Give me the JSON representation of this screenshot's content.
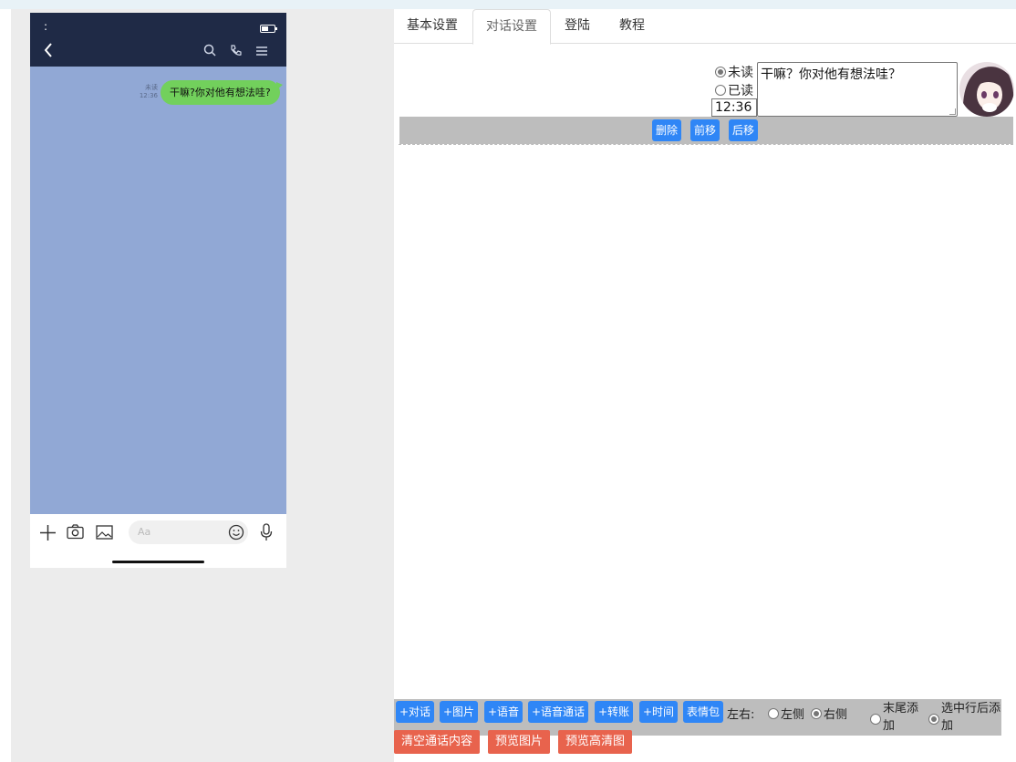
{
  "phone": {
    "status_left": ":",
    "message": {
      "status": "未读",
      "time": "12:36",
      "text": "干嘛?你对他有想法哇?"
    },
    "input_placeholder": "Aa",
    "colors": {
      "header": "#1f2a46",
      "chat_bg": "#91a8d5",
      "bubble": "#72d05c"
    }
  },
  "tabs": [
    {
      "label": "基本设置"
    },
    {
      "label": "对话设置"
    },
    {
      "label": "登陆"
    },
    {
      "label": "教程"
    }
  ],
  "active_tab": "对话设置",
  "dialog_row": {
    "unread_label": "未读",
    "read_label": "已读",
    "selected_status": "未读",
    "time_value": "12:36",
    "text_value": "干嘛？你对他有想法哇？",
    "actions": {
      "delete": "删除",
      "move_up": "前移",
      "move_down": "后移"
    }
  },
  "toolbar": {
    "add_dialog": "+对话",
    "add_image": "+图片",
    "add_voice": "+语音",
    "add_voice_call": "+语音通话",
    "add_transfer": "+转账",
    "add_time": "+时间",
    "sticker": "表情包",
    "side_label": "左右:",
    "left": "左侧",
    "right": "右侧",
    "selected_side": "右侧",
    "append_end": "末尾添加",
    "append_after": "选中行后添加",
    "selected_insert": "选中行后添加"
  },
  "bottom_actions": {
    "clear": "清空通话内容",
    "preview": "预览图片",
    "preview_hd": "预览高清图"
  },
  "colors": {
    "blue_button": "#2f86f6",
    "red_button": "#e8634d"
  }
}
